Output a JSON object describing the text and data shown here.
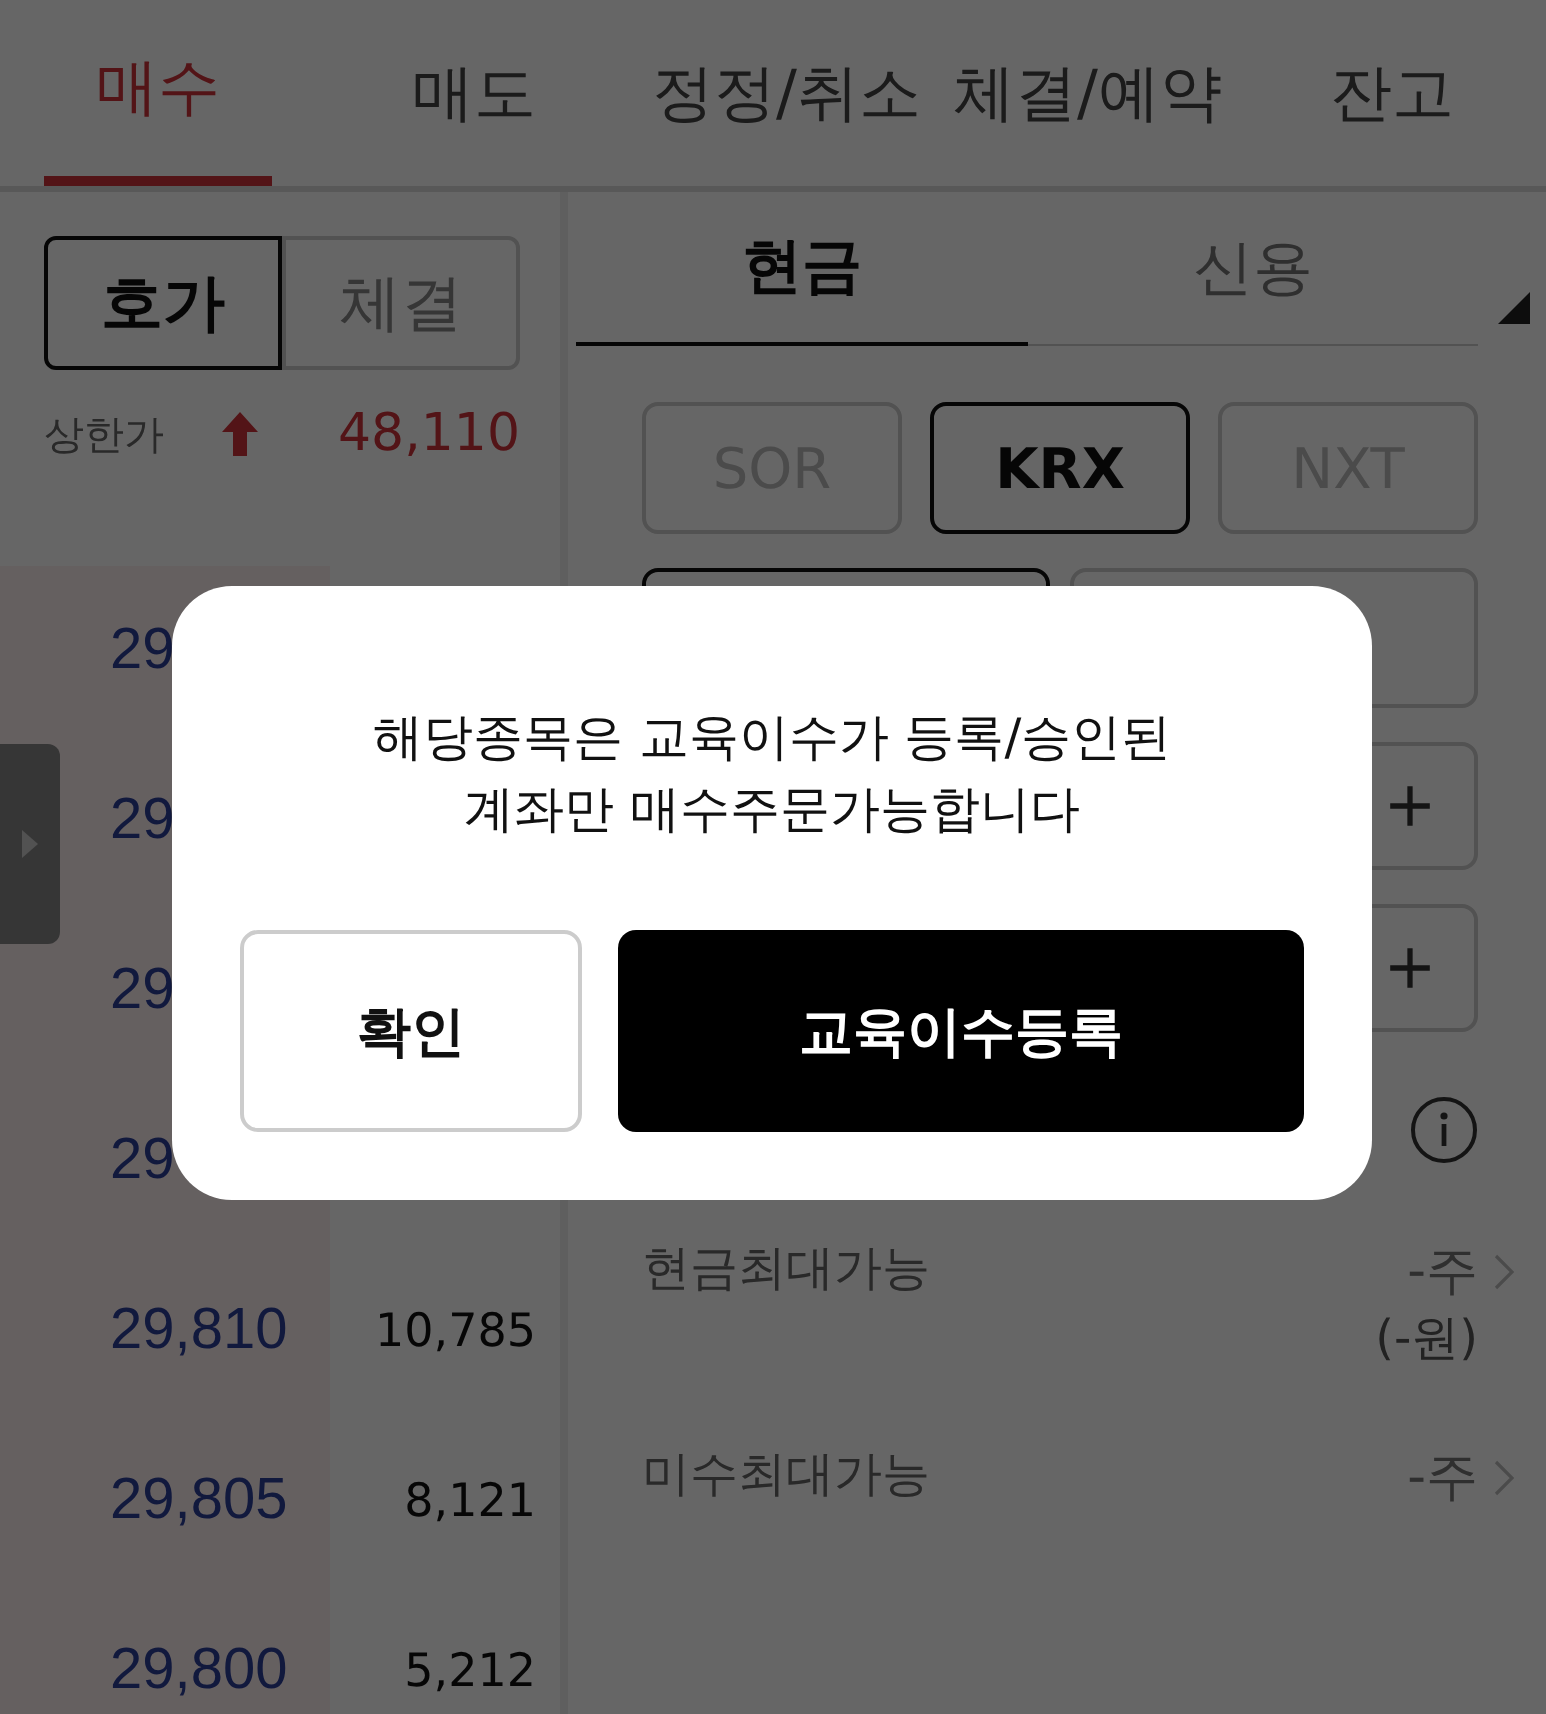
{
  "tabs": [
    {
      "label": "매수",
      "selected": true
    },
    {
      "label": "매도",
      "selected": false
    },
    {
      "label": "정정/취소",
      "selected": false
    },
    {
      "label": "체결/예약",
      "selected": false
    },
    {
      "label": "잔고",
      "selected": false
    }
  ],
  "quote_toggle": [
    {
      "label": "호가",
      "selected": true
    },
    {
      "label": "체결",
      "selected": false
    }
  ],
  "upper_limit": {
    "label": "상한가",
    "value": "48,110"
  },
  "orderbook": [
    {
      "price": "29"
    },
    {
      "price": "29"
    },
    {
      "price": "29"
    },
    {
      "price": "29"
    },
    {
      "price": "29,810",
      "quantity": "10,785"
    },
    {
      "price": "29,805",
      "quantity": "8,121"
    },
    {
      "price": "29,800",
      "quantity": "5,212"
    }
  ],
  "account_tabs": [
    {
      "label": "현금",
      "selected": true
    },
    {
      "label": "신용",
      "selected": false
    }
  ],
  "venues": [
    {
      "label": "SOR",
      "selected": false
    },
    {
      "label": "KRX",
      "selected": true
    },
    {
      "label": "NXT",
      "selected": false
    }
  ],
  "summary": [
    {
      "label": "현금최대가능",
      "value": "-주",
      "sub": "(-원)"
    },
    {
      "label": "미수최대가능",
      "value": "-주"
    }
  ],
  "dialog": {
    "message": [
      "해당종목은 교육이수가 등록/승인된",
      "계좌만 매수주문가능합니다"
    ],
    "buttons": [
      {
        "label": "확인",
        "kind": "secondary"
      },
      {
        "label": "교육이수등록",
        "kind": "primary"
      }
    ]
  }
}
